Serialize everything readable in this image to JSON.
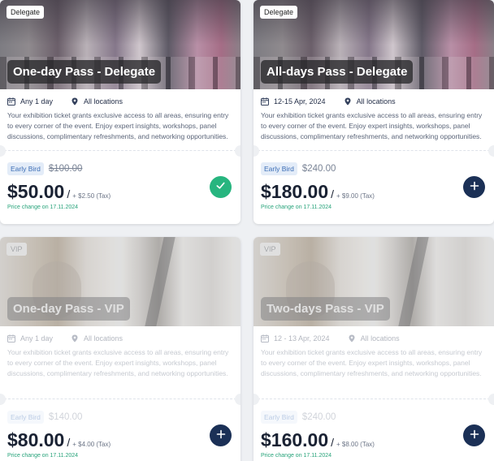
{
  "cards": [
    {
      "tag": "Delegate",
      "title": "One-day Pass - Delegate",
      "date": "Any 1 day",
      "location": "All locations",
      "description": "Your exhibition ticket grants exclusive access to all areas, ensuring entry to every corner of the event. Enjoy expert insights, workshops, panel discussions, complimentary refreshments, and networking opportunities.",
      "badge": "Early Bird",
      "original_price": "$100.00",
      "price": "$50.00",
      "slash": "/",
      "tax": "+ $2.50 (Tax)",
      "price_change": "Price change on 17.11.2024",
      "action": "selected"
    },
    {
      "tag": "Delegate",
      "title": "All-days Pass - Delegate",
      "date": "12-15 Apr, 2024",
      "location": "All locations",
      "description": "Your exhibition ticket grants exclusive access to all areas, ensuring entry to every corner of the event. Enjoy expert insights, workshops, panel discussions, complimentary refreshments, and networking opportunities.",
      "badge": "Early Bird",
      "original_price": "$240.00",
      "price": "$180.00",
      "slash": "/",
      "tax": "+ $9.00 (Tax)",
      "price_change": "Price change on 17.11.2024",
      "action": "add"
    },
    {
      "tag": "VIP",
      "title": "One-day Pass - VIP",
      "date": "Any 1 day",
      "location": "All locations",
      "description": "Your exhibition ticket grants exclusive access to all areas, ensuring entry to every corner of the event. Enjoy expert insights, workshops, panel discussions, complimentary refreshments, and networking opportunities.",
      "badge": "Early Bird",
      "original_price": "$140.00",
      "price": "$80.00",
      "slash": "/",
      "tax": "+ $4.00 (Tax)",
      "price_change": "Price change on 17.11.2024",
      "action": "add"
    },
    {
      "tag": "VIP",
      "title": "Two-days Pass - VIP",
      "date": "12 - 13 Apr, 2024",
      "location": "All locations",
      "description": "Your exhibition ticket grants exclusive access to all areas, ensuring entry to every corner of the event. Enjoy expert insights, workshops, panel discussions, complimentary refreshments, and networking opportunities.",
      "badge": "Early Bird",
      "original_price": "$240.00",
      "price": "$160.00",
      "slash": "/",
      "tax": "+ $8.00 (Tax)",
      "price_change": "Price change on 17.11.2024",
      "action": "add"
    }
  ],
  "icons": {
    "calendar": "calendar-icon",
    "location": "map-pin-icon",
    "add": "plus-icon",
    "selected": "check-icon"
  },
  "colors": {
    "primary": "#1b3056",
    "success": "#27b57f",
    "price_change": "#27a37a",
    "badge_bg": "#e3ecf8",
    "badge_text": "#3b6db5"
  }
}
